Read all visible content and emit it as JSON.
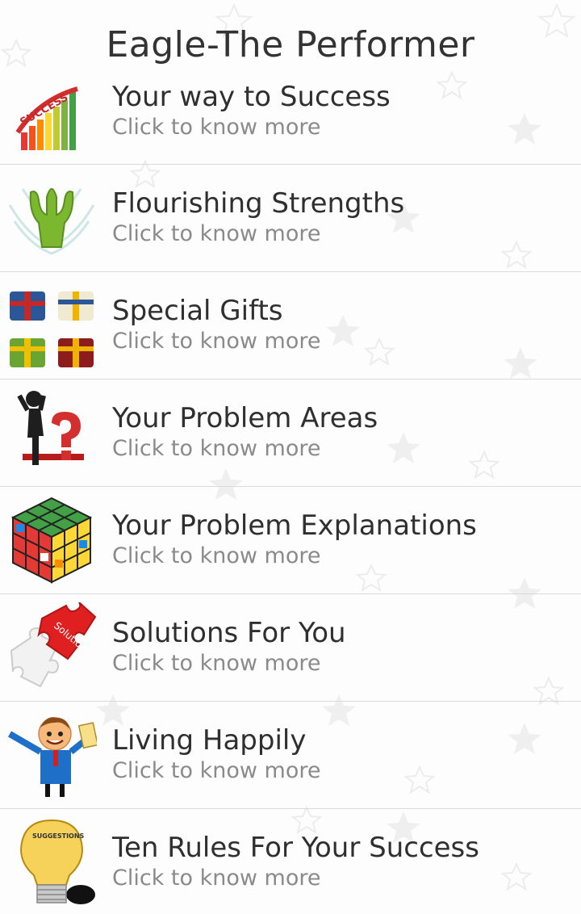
{
  "app": {
    "title": "Eagle-The Performer"
  },
  "items": [
    {
      "title": "Your way to Success",
      "subtitle": "Click to know more",
      "icon": "success-stairs-icon"
    },
    {
      "title": "Flourishing Strengths",
      "subtitle": "Click to know more",
      "icon": "strength-figure-icon"
    },
    {
      "title": "Special Gifts",
      "subtitle": "Click to know more",
      "icon": "gift-boxes-icon"
    },
    {
      "title": "Your Problem Areas",
      "subtitle": "Click to know more",
      "icon": "thinking-person-icon"
    },
    {
      "title": "Your Problem Explanations",
      "subtitle": "Click to know more",
      "icon": "rubiks-cube-icon"
    },
    {
      "title": "Solutions For You",
      "subtitle": "Click to know more",
      "icon": "puzzle-piece-icon"
    },
    {
      "title": "Living Happily",
      "subtitle": "Click to know more",
      "icon": "happy-man-icon"
    },
    {
      "title": "Ten Rules For Your Success",
      "subtitle": "Click to know more",
      "icon": "light-bulb-icon"
    }
  ],
  "icon_texts": {
    "solution_label": "Solution",
    "suggestions_label": "SUGGESTIONS"
  },
  "colors": {
    "title": "#333333",
    "subtitle": "#8a8a8a",
    "divider": "#d9d9d9"
  }
}
